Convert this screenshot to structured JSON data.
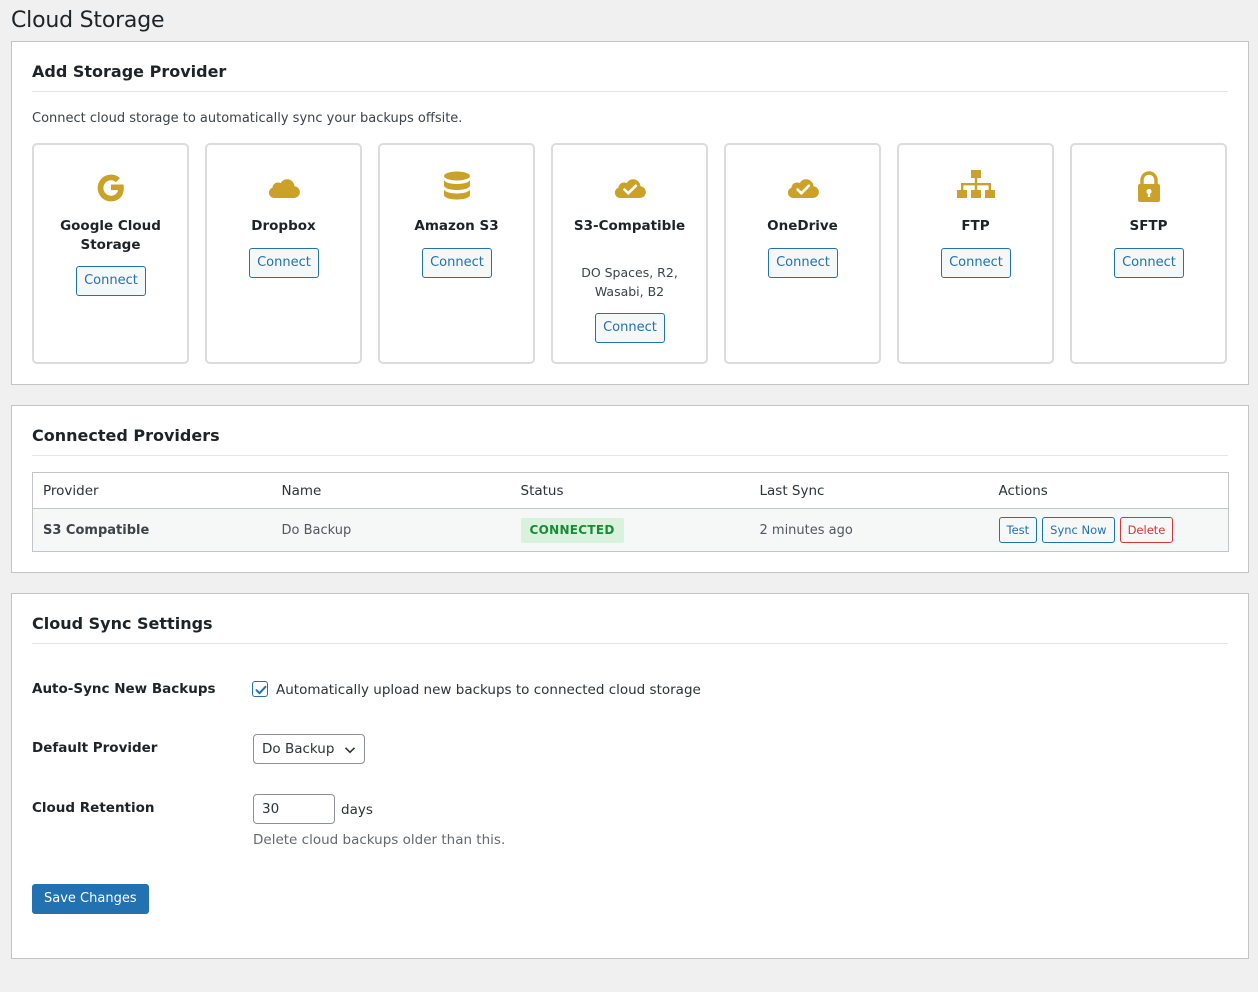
{
  "page": {
    "title": "Cloud Storage"
  },
  "colors": {
    "accent": "#2271b1",
    "icon": "#c9a227",
    "success": "#1a8a35",
    "danger": "#d63638"
  },
  "add_provider": {
    "heading": "Add Storage Provider",
    "intro": "Connect cloud storage to automatically sync your backups offsite.",
    "providers": [
      {
        "name": "Google Cloud Storage",
        "icon": "google-icon",
        "button": "Connect"
      },
      {
        "name": "Dropbox",
        "icon": "cloud-icon",
        "button": "Connect"
      },
      {
        "name": "Amazon S3",
        "icon": "database-icon",
        "button": "Connect"
      },
      {
        "name": "S3-Compatible",
        "icon": "cloud-check-icon",
        "description": "DO Spaces, R2, Wasabi, B2",
        "button": "Connect"
      },
      {
        "name": "OneDrive",
        "icon": "cloud-check-icon",
        "button": "Connect"
      },
      {
        "name": "FTP",
        "icon": "sitemap-icon",
        "button": "Connect"
      },
      {
        "name": "SFTP",
        "icon": "lock-icon",
        "button": "Connect"
      }
    ]
  },
  "connected": {
    "heading": "Connected Providers",
    "columns": [
      "Provider",
      "Name",
      "Status",
      "Last Sync",
      "Actions"
    ],
    "rows": [
      {
        "provider": "S3 Compatible",
        "name": "Do Backup",
        "status": "CONNECTED",
        "last_sync": "2 minutes ago",
        "actions": [
          "Test",
          "Sync Now",
          "Delete"
        ]
      }
    ]
  },
  "settings": {
    "heading": "Cloud Sync Settings",
    "auto_sync": {
      "label": "Auto-Sync New Backups",
      "checked": true,
      "text": "Automatically upload new backups to connected cloud storage"
    },
    "default_provider": {
      "label": "Default Provider",
      "value": "Do Backup"
    },
    "retention": {
      "label": "Cloud Retention",
      "value": "30",
      "unit": "days",
      "hint": "Delete cloud backups older than this."
    },
    "save_label": "Save Changes"
  }
}
